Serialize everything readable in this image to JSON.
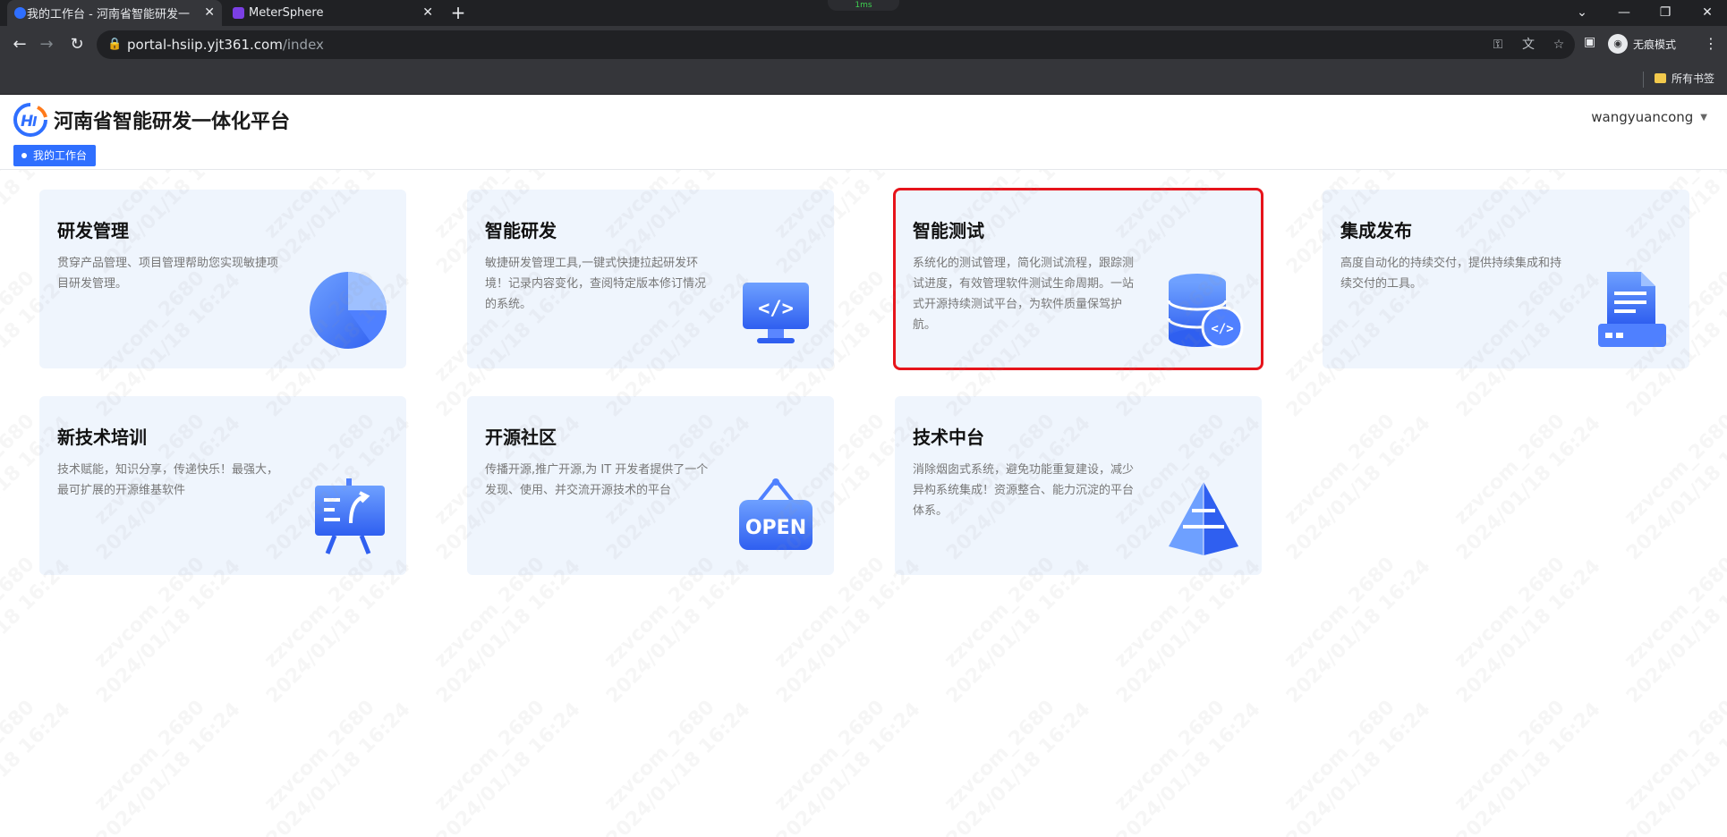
{
  "browser": {
    "tabs": [
      {
        "title": "我的工作台 - 河南省智能研发一",
        "active": true,
        "favicon_color": "#2f6fff"
      },
      {
        "title": "MeterSphere",
        "active": false,
        "favicon_color": "#7b3fe4"
      }
    ],
    "latency": "1ms",
    "url_host": "portal-hsiip.yjt361.com",
    "url_path": "/index",
    "incognito_label": "无痕模式",
    "bookmarks_label": "所有书签"
  },
  "header": {
    "site_title": "河南省智能研发一体化平台",
    "username": "wangyuancong",
    "active_tag": "我的工作台"
  },
  "cards": [
    {
      "title": "研发管理",
      "desc": "贯穿产品管理、项目管理帮助您实现敏捷项目研发管理。",
      "icon": "pie-chart-icon"
    },
    {
      "title": "智能研发",
      "desc": "敏捷研发管理工具,一键式快捷拉起研发环境！记录内容变化，查阅特定版本修订情况的系统。",
      "icon": "code-monitor-icon"
    },
    {
      "title": "智能测试",
      "desc": "系统化的测试管理，简化测试流程，跟踪测试进度，有效管理软件测试生命周期。一站式开源持续测试平台，为软件质量保驾护航。",
      "icon": "database-code-icon"
    },
    {
      "title": "集成发布",
      "desc": "高度自动化的持续交付，提供持续集成和持续交付的工具。",
      "icon": "document-server-icon"
    },
    {
      "title": "新技术培训",
      "desc": "技术赋能，知识分享，传递快乐！最强大，最可扩展的开源维基软件",
      "icon": "presentation-board-icon"
    },
    {
      "title": "开源社区",
      "desc": "传播开源,推广开源,为 IT 开发者提供了一个发现、使用、并交流开源技术的平台",
      "icon": "open-sign-icon"
    },
    {
      "title": "技术中台",
      "desc": "消除烟囱式系统，避免功能重复建设，减少异构系统集成！资源整合、能力沉淀的平台体系。",
      "icon": "pyramid-icon"
    }
  ],
  "watermark": {
    "line1": "zzvcom_2680",
    "line2": "2024/01/18 16:24"
  },
  "colors": {
    "accent": "#2f6fff",
    "card_bg": "#eff5fd",
    "selection": "#e6141b"
  }
}
